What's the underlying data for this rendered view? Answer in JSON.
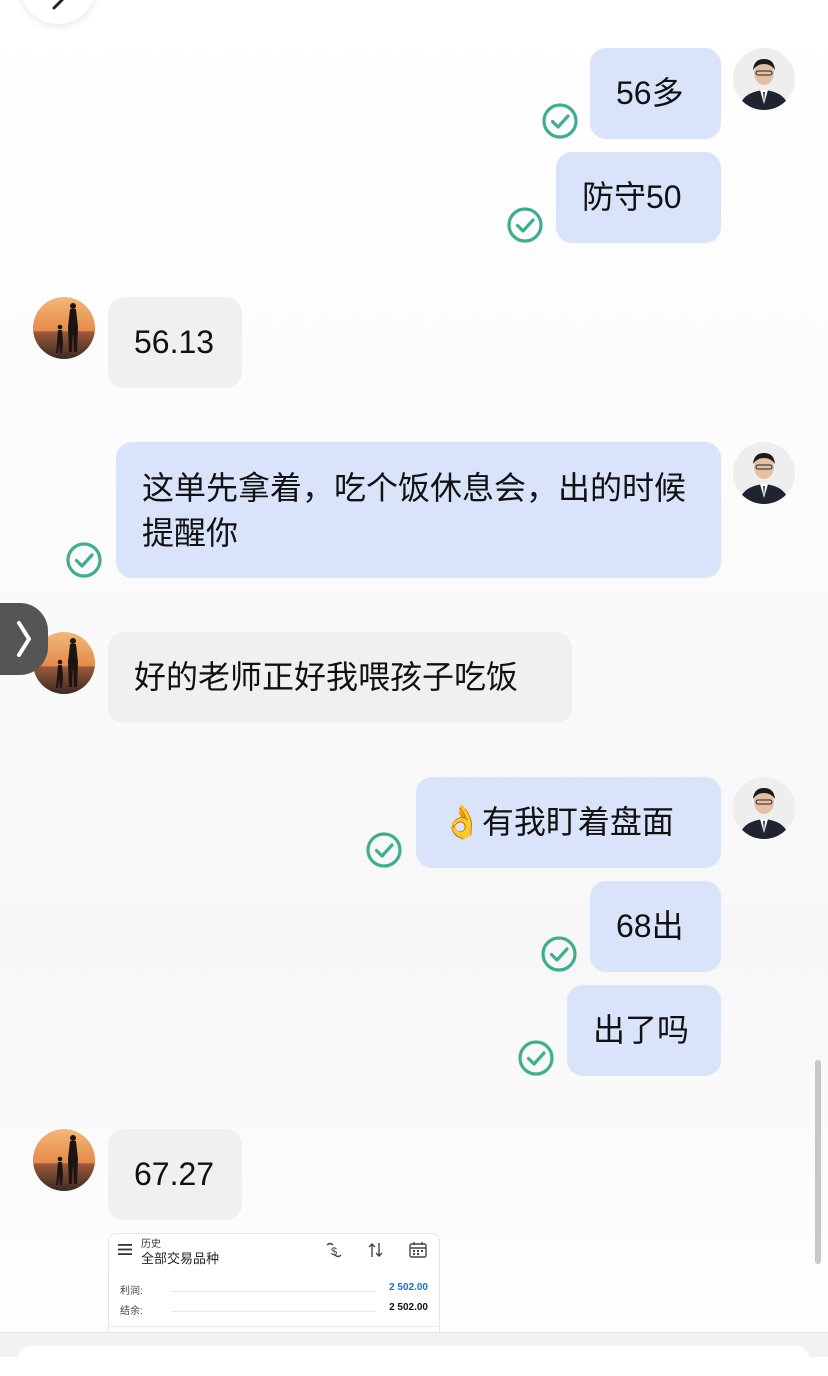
{
  "colors": {
    "outgoing_bubble": "#d9e4fb",
    "incoming_bubble": "#f0f0f0",
    "read_check": "#3fae8c",
    "profit_value": "#1a6fd1"
  },
  "icons": {
    "back": "chevron-left-icon",
    "read_status": "check-circle-icon",
    "side_tab": "chevron-right-icon"
  },
  "messages": [
    {
      "from": "me",
      "text": "56多"
    },
    {
      "from": "me",
      "text": "防守50"
    },
    {
      "from": "other",
      "text": "56.13"
    },
    {
      "from": "me",
      "text": "这单先拿着，吃个饭休息会，出的时候提醒你"
    },
    {
      "from": "other",
      "text": "好的老师正好我喂孩子吃饭"
    },
    {
      "from": "me",
      "emoji": "👌",
      "text": "有我盯着盘面"
    },
    {
      "from": "me",
      "text": "68出"
    },
    {
      "from": "me",
      "text": "出了吗"
    },
    {
      "from": "other",
      "text": "67.27"
    }
  ],
  "screenshot": {
    "menu_small": "历史",
    "title": "全部交易品种",
    "rows": [
      {
        "label": "利润:",
        "value": "2 502.00"
      },
      {
        "label": "结余:",
        "value": "2 502.00"
      }
    ]
  }
}
